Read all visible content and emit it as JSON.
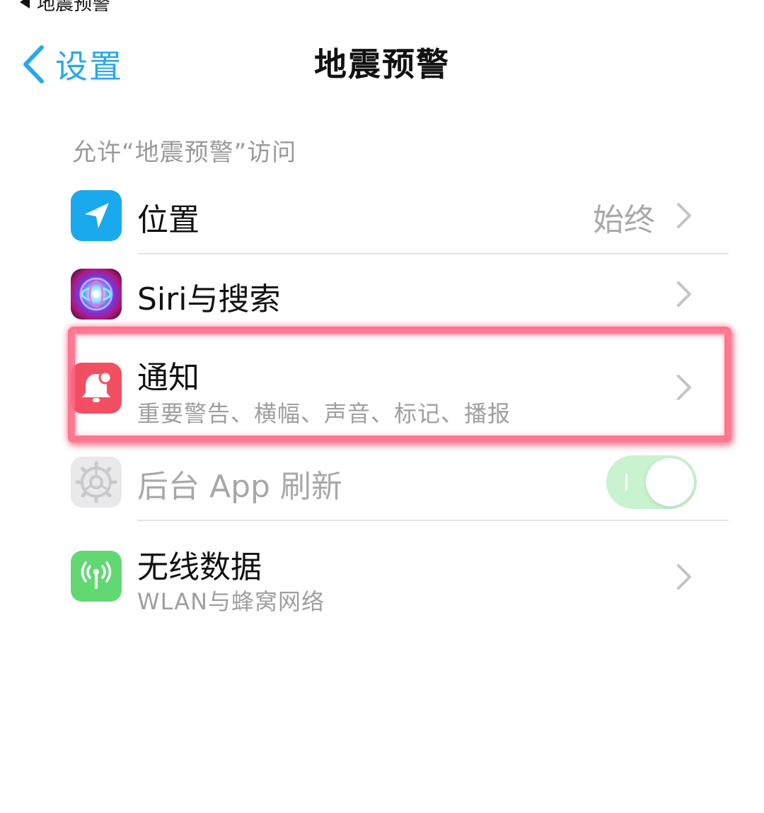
{
  "status_bar": {
    "back_app_label": "地震预警"
  },
  "nav": {
    "back_label": "设置",
    "title": "地震预警"
  },
  "section": {
    "header": "允许“地震预警”访问"
  },
  "rows": [
    {
      "id": "location",
      "label": "位置",
      "value": "始终",
      "icon": "location-arrow-icon",
      "icon_color": "#19a9ec"
    },
    {
      "id": "siri",
      "label": "Siri与搜索",
      "icon": "siri-icon"
    },
    {
      "id": "notifications",
      "label": "通知",
      "sublabel": "重要警告、横幅、声音、标记、播报",
      "icon": "bell-icon",
      "icon_color": "#f24f62",
      "highlighted": true
    },
    {
      "id": "background_refresh",
      "label": "后台 App 刷新",
      "icon": "gear-icon",
      "icon_color": "#e9e9ec",
      "toggle_on": true,
      "disabled": true
    },
    {
      "id": "wireless_data",
      "label": "无线数据",
      "sublabel": "WLAN与蜂窝网络",
      "icon": "antenna-icon",
      "icon_color": "#62d873"
    }
  ],
  "colors": {
    "accent": "#2aa8e8",
    "highlight": "#fc5070",
    "toggle_on_dimmed": "#c9f2cf"
  }
}
